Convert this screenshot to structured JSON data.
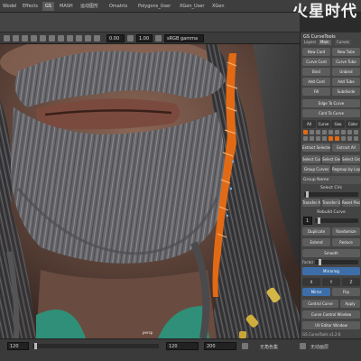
{
  "app": {
    "watermark": "火星时代"
  },
  "shelf": {
    "tabs": [
      "Wodel",
      "Effects",
      "GS",
      "MASH",
      "运动图形",
      "Omatrix",
      "Polygons_User",
      "XGen_User",
      "XGen"
    ],
    "active_index": 2
  },
  "viewport_toolbar": {
    "field_near": "0.00",
    "field_far": "1.00",
    "colorspace": "sRGB gamma"
  },
  "viewport": {
    "camera_label": "persp"
  },
  "gs_panel": {
    "title": "GS CurveTools",
    "tabs": [
      "Layers",
      "Main",
      "Curves"
    ],
    "rows": [
      [
        "New Card",
        "New Tube"
      ],
      [
        "Curve Card",
        "Curve Tube"
      ],
      [
        "Bind",
        "Unbind"
      ],
      [
        "Add Card",
        "Add Tube"
      ],
      [
        "Fill",
        "Subdivide"
      ]
    ],
    "edge_to_curve": "Edge To Curve",
    "card_to_curve": "Card To Curve",
    "filter_row": [
      "All",
      "Curve",
      "Geo",
      "Color"
    ],
    "extract_buttons": [
      "Extract Selected",
      "Extract All"
    ],
    "group_row": [
      "Select Curve",
      "Select Geo",
      "Select Group"
    ],
    "group_row_2": [
      "Group Curves",
      "Regroup by Layer"
    ],
    "group_name_label": "Group Name",
    "select_cvs_label": "Select CVs",
    "transfer_row": [
      "Transfer Attr",
      "Transfer UVs",
      "Reset Pivot"
    ],
    "rebuild_label": "Rebuild Curve",
    "rebuild_value": "1",
    "duplicate": "Duplicate",
    "randomize": "Randomize",
    "extend": "Extend",
    "reduce": "Reduce",
    "smooth": "Smooth",
    "factor_label": "Factor",
    "mirroring": "Mirroring",
    "axes": [
      "X",
      "Y",
      "Z"
    ],
    "mirror": "Mirror",
    "flip": "Flip",
    "control_curve": "Control Curve",
    "apply": "Apply",
    "curve_control_window": "Curve Control Window",
    "uv_editor_window": "UV Editor Window",
    "footer": "GS CurveTools v1.2.6"
  },
  "timeline": {
    "current_frame": "120",
    "range_end_left": "120",
    "range_start": "120",
    "range_end": "200",
    "anim_layer": "无角色集",
    "no_anim_layer": "无动画层"
  },
  "colors": {
    "accent_blue": "#3e6ea8",
    "orange_strip": "#e36a14",
    "beard_gray": "#6b6b6f"
  }
}
